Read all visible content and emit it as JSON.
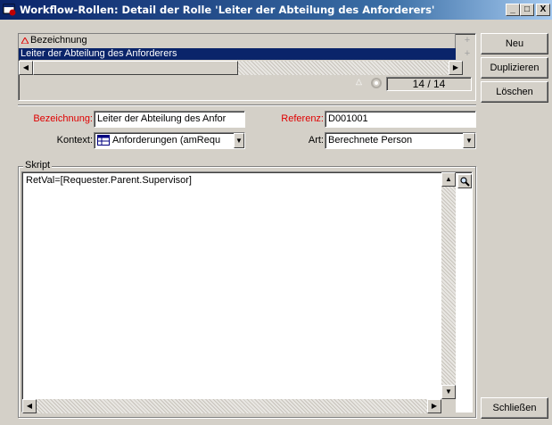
{
  "window": {
    "title": "Workflow-Rollen: Detail der Rolle 'Leiter der Abteilung des Anforderers'",
    "minimize_glyph": "_",
    "maximize_glyph": "□",
    "close_glyph": "X"
  },
  "list": {
    "column_header": "Bezeichnung",
    "rows": [
      "Leiter der Abteilung des Anforderers"
    ],
    "record_counter": "14 / 14"
  },
  "buttons": {
    "new": "Neu",
    "duplicate": "Duplizieren",
    "delete": "Löschen",
    "close": "Schließen"
  },
  "form": {
    "bezeichnung_label": "Bezeichnung:",
    "bezeichnung_value": "Leiter der Abteilung des Anfor",
    "referenz_label": "Referenz:",
    "referenz_value": "D001001",
    "kontext_label": "Kontext:",
    "kontext_value": "Anforderungen (amRequ",
    "art_label": "Art:",
    "art_value": "Berechnete Person"
  },
  "script": {
    "group_label": "Skript",
    "code": "RetVal=[Requester.Parent.Supervisor]"
  },
  "colors": {
    "title_gradient_start": "#0a246a",
    "selection": "#0a246a",
    "required_label": "#e00000",
    "face": "#d4d0c8"
  },
  "icons": [
    "app-icon",
    "sort-triangle-icon",
    "table-icon",
    "magnifier-icon",
    "arrow-left-icon",
    "arrow-right-icon",
    "arrow-up-icon",
    "arrow-down-icon",
    "dropdown-arrow-icon"
  ]
}
